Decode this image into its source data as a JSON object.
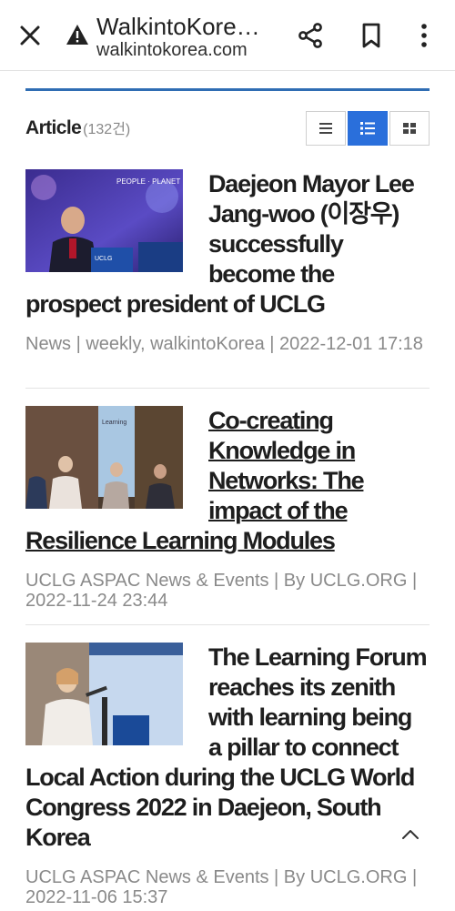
{
  "browser": {
    "title": "WalkintoKore…",
    "url": "walkintokorea.com",
    "icons": [
      "close-icon",
      "warning-icon",
      "share-icon",
      "bookmark-icon",
      "more-vert-icon"
    ]
  },
  "list": {
    "title": "Article",
    "count": "(132건)",
    "views": [
      "list-view-icon",
      "detailed-list-view-icon",
      "grid-view-icon"
    ],
    "active_view": "detailed-list-view-icon"
  },
  "articles": [
    {
      "headline": "Daejeon Mayor Lee Jang-woo (이장우) successfully become the prospect president of UCLG",
      "meta": "News | weekly, walkintoKorea | 2022-12-01 17:18",
      "underlined": false
    },
    {
      "headline": "Co-creating Knowledge in Networks: The impact of the Resilience Learning Modules",
      "meta": "UCLG ASPAC News & Events | By UCLG.ORG | 2022-11-24 23:44",
      "underlined": true
    },
    {
      "headline": "The Learning Forum reaches its zenith with learning being a pillar to connect Local Action during the UCLG World Congress 2022 in Daejeon, South Korea",
      "meta": "UCLG ASPAC News & Events | By UCLG.ORG | 2022-11-06 15:37",
      "underlined": false
    }
  ],
  "colors": {
    "accent": "#2a6fdb",
    "rule": "#2f6db3",
    "meta_text": "#8a8a8a"
  }
}
